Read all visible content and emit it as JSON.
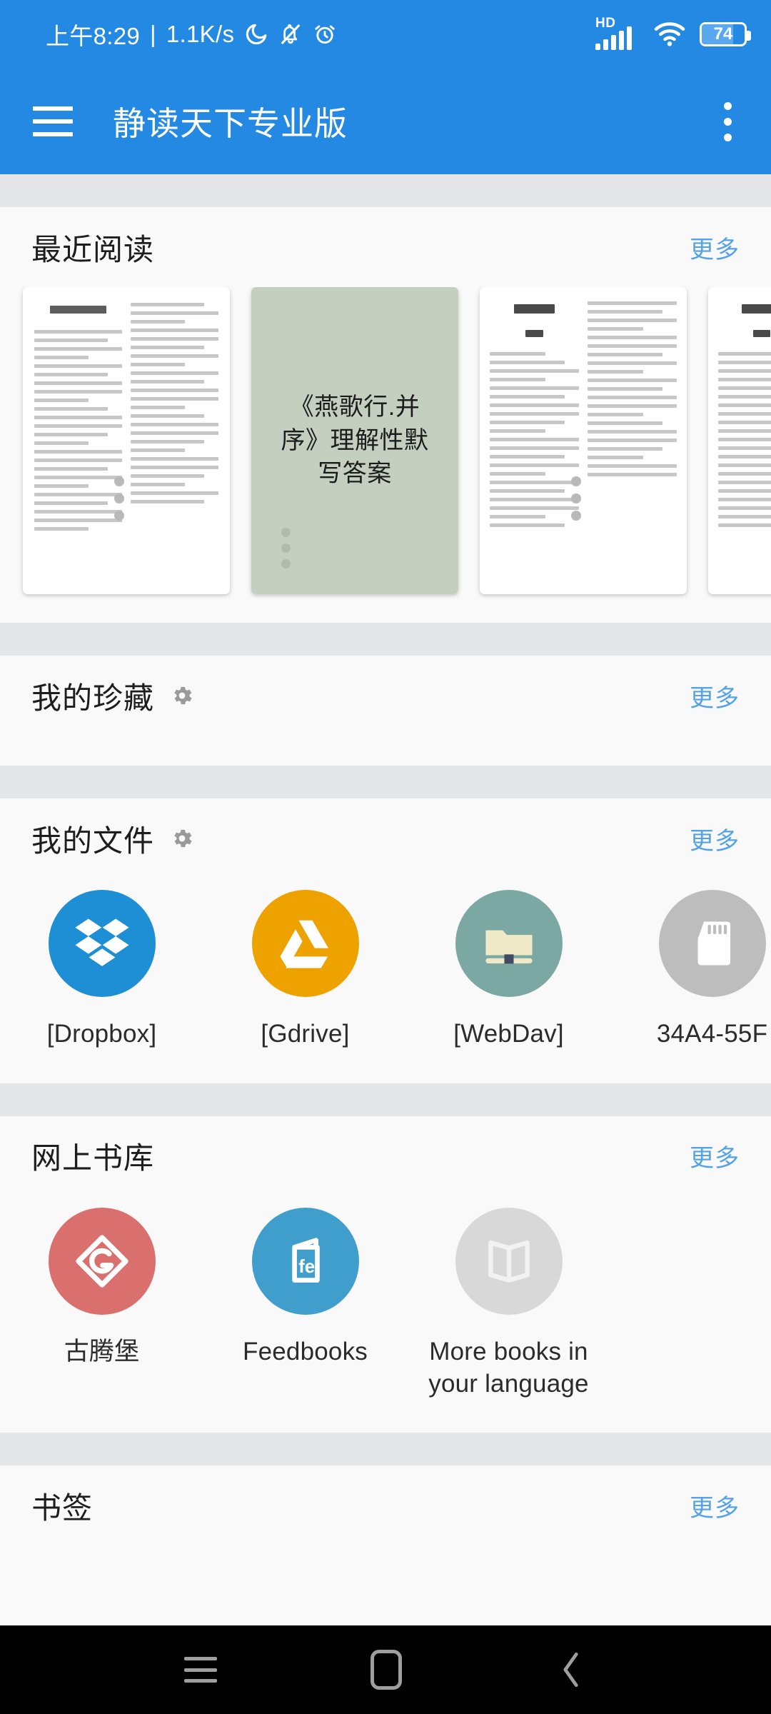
{
  "statusbar": {
    "time": "上午8:29",
    "separator": "|",
    "netspeed": "1.1K/s",
    "icons": [
      "moon-icon",
      "bell-off-icon",
      "alarm-icon"
    ],
    "signal_label": "HD",
    "battery_level": "74",
    "battery_percent": 74,
    "bg_color": "#2489e3"
  },
  "appbar": {
    "menu_icon": "hamburger-icon",
    "title": "静读天下专业版",
    "overflow_icon": "kebab-menu-icon",
    "bg_color": "#2489e3"
  },
  "sections": {
    "recent": {
      "title": "最近阅读",
      "more_label": "更多",
      "books": [
        {
          "kind": "doc-scan",
          "title": ""
        },
        {
          "kind": "text-cover",
          "title": "《燕歌行.并序》理解性默写答案",
          "bg": "#c4cfc0"
        },
        {
          "kind": "doc-scan-2",
          "title": ""
        },
        {
          "kind": "doc-scan-2",
          "title": ""
        }
      ]
    },
    "collection": {
      "title": "我的珍藏",
      "settings_icon": "gear-icon",
      "more_label": "更多"
    },
    "files": {
      "title": "我的文件",
      "settings_icon": "gear-icon",
      "more_label": "更多",
      "items": [
        {
          "label": "[Dropbox]",
          "icon": "dropbox-icon",
          "color": "#1e8fd5"
        },
        {
          "label": "[Gdrive]",
          "icon": "gdrive-icon",
          "color": "#eda200"
        },
        {
          "label": "[WebDav]",
          "icon": "webdav-icon",
          "color": "#7ca8a4"
        },
        {
          "label": "34A4-55F",
          "icon": "sdcard-icon",
          "color": "#bdbdbd"
        }
      ]
    },
    "online": {
      "title": "网上书库",
      "more_label": "更多",
      "items": [
        {
          "label": "古腾堡",
          "icon": "gutenberg-icon",
          "color": "#d9706e"
        },
        {
          "label": "Feedbooks",
          "icon": "feedbooks-icon",
          "color": "#409ecc"
        },
        {
          "label": "More books in your language",
          "icon": "open-book-icon",
          "color": "#d8d8d8"
        }
      ]
    },
    "bookmarks": {
      "title": "书签",
      "more_label": "更多"
    }
  },
  "navbar": {
    "recents_icon": "recents-icon",
    "home_icon": "home-icon",
    "back_icon": "back-icon",
    "bg_color": "#000000"
  },
  "theme": {
    "accent": "#2489e3",
    "link": "#55a2e8",
    "section_bg": "#f9f9f9",
    "divider": "#e5e6e7"
  }
}
